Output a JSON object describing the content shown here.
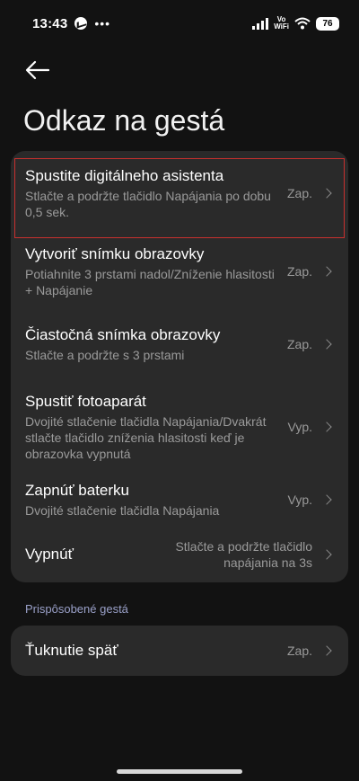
{
  "status_bar": {
    "time": "13:43",
    "vowifi_top": "Vo",
    "vowifi_bottom": "WiFi",
    "battery": "76"
  },
  "header": {
    "title": "Odkaz na gestá"
  },
  "gestures": [
    {
      "title": "Spustite digitálneho asistenta",
      "subtitle": "Stlačte a podržte tlačidlo Napájania po dobu 0,5 sek.",
      "value": "Zap."
    },
    {
      "title": "Vytvoriť snímku obrazovky",
      "subtitle": "Potiahnite 3 prstami nadol/Zníženie hlasitosti + Napájanie",
      "value": "Zap."
    },
    {
      "title": "Čiastočná snímka obrazovky",
      "subtitle": "Stlačte a podržte s 3 prstami",
      "value": "Zap."
    },
    {
      "title": "Spustiť fotoaparát",
      "subtitle": "Dvojité stlačenie tlačidla Napájania/Dvakrát stlačte tlačidlo zníženia hlasitosti keď je obrazovka vypnutá",
      "value": "Vyp."
    },
    {
      "title": "Zapnúť baterku",
      "subtitle": "Dvojité stlačenie tlačidla Napájania",
      "value": "Vyp."
    },
    {
      "title": "Vypnúť",
      "value": "Stlačte a podržte tlačidlo napájania na 3s"
    }
  ],
  "custom_section": {
    "header": "Prispôsobené gestá",
    "items": [
      {
        "title": "Ťuknutie späť",
        "value": "Zap."
      }
    ]
  },
  "colors": {
    "background": "#121212",
    "card": "#2a2a2a",
    "highlight": "#c8302e",
    "section_header": "#9aa0c8"
  }
}
